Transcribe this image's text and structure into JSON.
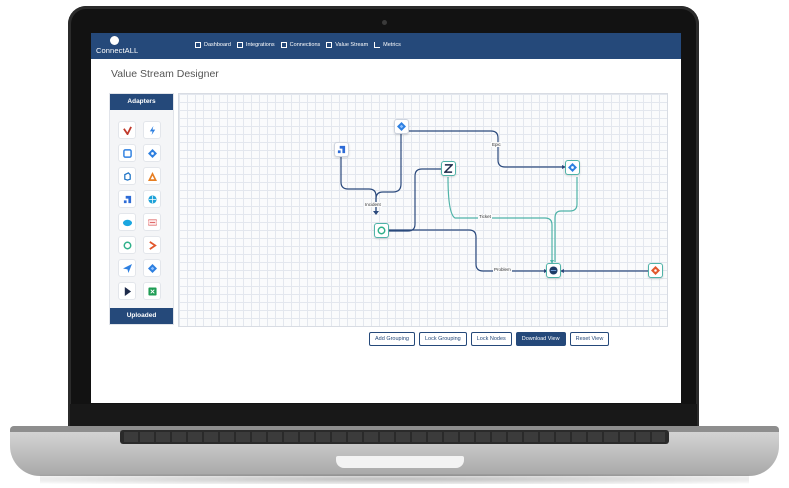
{
  "app": {
    "brand": "ConnectALL"
  },
  "nav": [
    {
      "label": "Dashboard",
      "icon": "dashboard-icon"
    },
    {
      "label": "Integrations",
      "icon": "integrations-icon"
    },
    {
      "label": "Connections",
      "icon": "connections-icon"
    },
    {
      "label": "Value Stream",
      "icon": "value-stream-icon"
    },
    {
      "label": "Metrics",
      "icon": "metrics-icon"
    }
  ],
  "page": {
    "title": "Value Stream Designer"
  },
  "sidebar": {
    "header": "Adapters",
    "footer": "Uploaded",
    "adapters": [
      {
        "icon": "red-check-adapter-icon",
        "color": "#c0392b"
      },
      {
        "icon": "bolt-adapter-icon",
        "color": "#2d7fe0"
      },
      {
        "icon": "square-adapter-icon",
        "color": "#2d7fe0"
      },
      {
        "icon": "diamond-adapter-icon",
        "color": "#2d7fe0"
      },
      {
        "icon": "azure-adapter-icon",
        "color": "#1f74c6"
      },
      {
        "icon": "triangle-adapter-icon",
        "color": "#e67e22"
      },
      {
        "icon": "corner-adapter-icon",
        "color": "#2d6bd6"
      },
      {
        "icon": "globe-adapter-icon",
        "color": "#1da1d8"
      },
      {
        "icon": "cloud-adapter-icon",
        "color": "#1aa6e0"
      },
      {
        "icon": "label-adapter-icon",
        "color": "#d94c4c"
      },
      {
        "icon": "ring-adapter-icon",
        "color": "#2fb08a"
      },
      {
        "icon": "chevron-adapter-icon",
        "color": "#e2572c"
      },
      {
        "icon": "send-adapter-icon",
        "color": "#2d7fe0"
      },
      {
        "icon": "jira-adapter-icon",
        "color": "#2d7fe0"
      },
      {
        "icon": "play-adapter-icon",
        "color": "#1d2a4a"
      },
      {
        "icon": "sheet-adapter-icon",
        "color": "#1f9d55"
      }
    ]
  },
  "diagram": {
    "edge_labels": {
      "incident": "Incident",
      "epic": "Epic",
      "ticket": "Ticket",
      "problem": "Problem"
    },
    "colors": {
      "link_dark": "#2b4a7d",
      "link_teal": "#4fb3a8"
    }
  },
  "actions": [
    {
      "label": "Add Grouping",
      "primary": false
    },
    {
      "label": "Lock Grouping",
      "primary": false
    },
    {
      "label": "Lock Nodes",
      "primary": false
    },
    {
      "label": "Download View",
      "primary": true
    },
    {
      "label": "Reset View",
      "primary": false
    }
  ]
}
